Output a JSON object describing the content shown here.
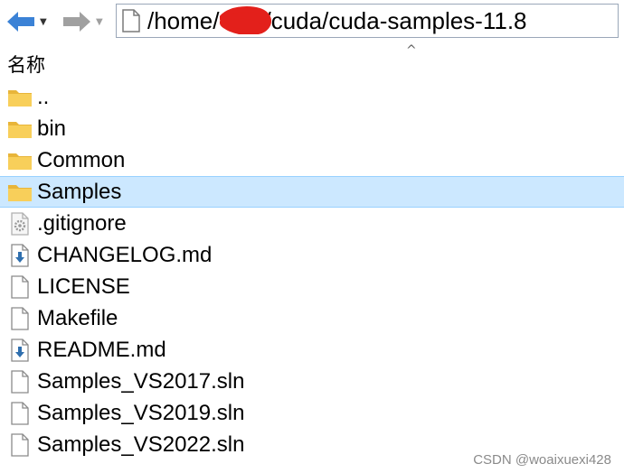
{
  "toolbar": {
    "back_icon": "back-arrow-icon",
    "forward_icon": "forward-arrow-icon",
    "dropdown_glyph": "▼"
  },
  "address_bar": {
    "path_prefix": "/home/",
    "path_suffix": "/cuda/cuda-samples-11.8",
    "path_redacted": true
  },
  "column_header": {
    "name_label": "名称",
    "sort_glyph": "^"
  },
  "files": [
    {
      "name": "..",
      "icon": "folder-icon",
      "type": "folder"
    },
    {
      "name": "bin",
      "icon": "folder-icon",
      "type": "folder"
    },
    {
      "name": "Common",
      "icon": "folder-icon",
      "type": "folder"
    },
    {
      "name": "Samples",
      "icon": "folder-icon",
      "type": "folder",
      "selected": true
    },
    {
      "name": ".gitignore",
      "icon": "settings-file-icon",
      "type": "file"
    },
    {
      "name": "CHANGELOG.md",
      "icon": "download-file-icon",
      "type": "file"
    },
    {
      "name": "LICENSE",
      "icon": "blank-file-icon",
      "type": "file"
    },
    {
      "name": "Makefile",
      "icon": "blank-file-icon",
      "type": "file"
    },
    {
      "name": "README.md",
      "icon": "download-file-icon",
      "type": "file"
    },
    {
      "name": "Samples_VS2017.sln",
      "icon": "blank-file-icon",
      "type": "file"
    },
    {
      "name": "Samples_VS2019.sln",
      "icon": "blank-file-icon",
      "type": "file"
    },
    {
      "name": "Samples_VS2022.sln",
      "icon": "blank-file-icon",
      "type": "file"
    }
  ],
  "watermark": "CSDN @woaixuexi428",
  "colors": {
    "selection_bg": "#cce8ff",
    "selection_border": "#99d1ff",
    "folder": "#f5c242",
    "nav_back": "#3b82d6",
    "nav_disabled": "#a0a0a0"
  }
}
